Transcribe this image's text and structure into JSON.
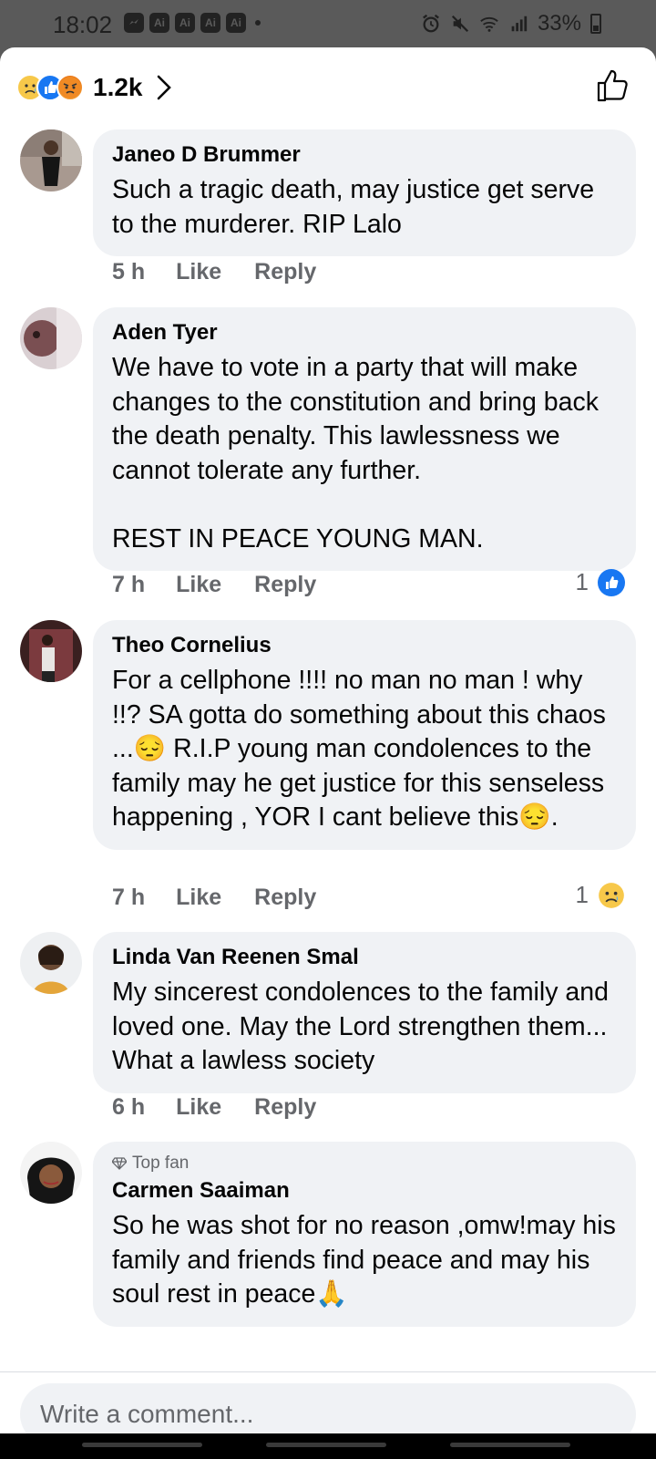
{
  "status_bar": {
    "time": "18:02",
    "apps": [
      "messenger-icon",
      "Ai",
      "Ai",
      "Ai",
      "Ai"
    ],
    "app_labels": [
      "",
      "Ai",
      "Ai",
      "Ai",
      "Ai"
    ],
    "battery": "33%"
  },
  "reactions": {
    "count": "1.2k",
    "types": [
      "sad",
      "like",
      "angry"
    ]
  },
  "comments": [
    {
      "name": "Janeo D Brummer",
      "text": "Such a tragic death, may justice get serve to the murderer. RIP Lalo",
      "age": "5 h",
      "like_label": "Like",
      "reply_label": "Reply"
    },
    {
      "name": "Aden Tyer",
      "text": "We have to vote in a party that will make changes to the constitution and bring back the death penalty. This lawlessness we cannot tolerate any further.\n\nREST IN PEACE YOUNG MAN.",
      "age": "7 h",
      "like_label": "Like",
      "reply_label": "Reply",
      "reaction_count": "1",
      "reaction_type": "like"
    },
    {
      "name": "Theo Cornelius",
      "text": "For a cellphone !!!! no man no man ! why !!? SA gotta do something about this chaos ...😔 R.I.P young man condolences to the family may he get justice for this senseless happening , YOR I cant believe this😔.",
      "age": "7 h",
      "like_label": "Like",
      "reply_label": "Reply",
      "reaction_count": "1",
      "reaction_type": "sad"
    },
    {
      "name": "Linda Van Reenen Smal",
      "text": "My sincerest condolences to the family and loved one. May the Lord strengthen them... What a lawless society",
      "age": "6 h",
      "like_label": "Like",
      "reply_label": "Reply"
    },
    {
      "badge": "Top fan",
      "name": "Carmen Saaiman",
      "text": "So he was shot for no reason ,omw!may his family and friends find peace and may his soul rest in peace🙏"
    }
  ],
  "composer": {
    "placeholder": "Write a comment..."
  },
  "colors": {
    "bubble": "#f0f2f5",
    "meta_text": "#65676b",
    "like_blue": "#1877f2",
    "sad_yellow": "#f7c84a"
  }
}
